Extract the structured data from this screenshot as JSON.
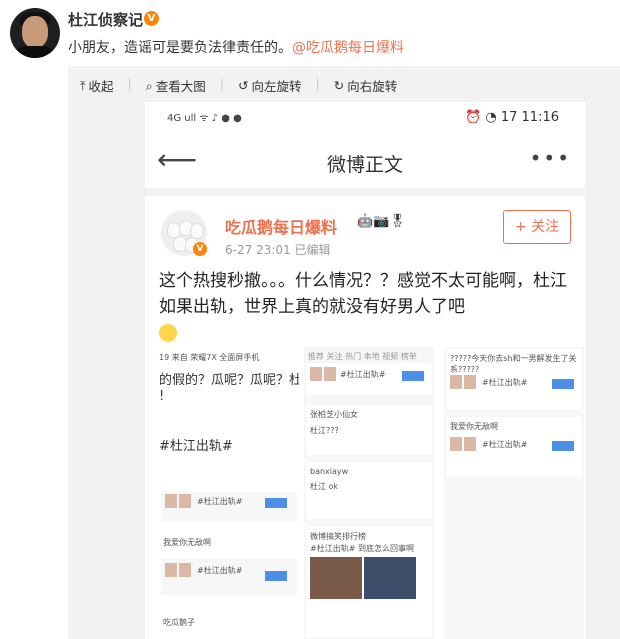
{
  "post": {
    "username": "杜江侦察记",
    "verified_badge": "V",
    "text": "小朋友，造谣可是要负法律责任的。",
    "mention": "@吃瓜鹅每日爆料"
  },
  "toolbar": {
    "items": [
      {
        "icon": "collapse-icon",
        "glyph": "⤒",
        "label": "收起"
      },
      {
        "icon": "search-icon",
        "glyph": "⌕",
        "label": "查看大图"
      },
      {
        "icon": "rotate-left-icon",
        "glyph": "↺",
        "label": "向左旋转"
      },
      {
        "icon": "rotate-right-icon",
        "glyph": "↻",
        "label": "向右旋转"
      }
    ]
  },
  "screenshot": {
    "status_left": "4G ull ᯤ ♪ ● ●",
    "status_right": "⏰ ◔ 17 11:16",
    "nav_title": "微博正文",
    "back_glyph": "⟵",
    "more_glyph": "•••",
    "repost": {
      "name": "吃瓜鹅每日爆料",
      "meta": "6-27 23:01  已编辑",
      "follow_label": "+ 关注",
      "badges": "🤖📷🎖",
      "text": "这个热搜秒撤。。。什么情况？？感觉不太可能啊，杜江如果出轨，世界上真的就没有好男人了吧"
    },
    "left_col": {
      "line1": "19  来自 荣耀7X 全面屏手机",
      "line2": "的假的？瓜呢？瓜呢？杜江和",
      "line3": "!",
      "line4": "#杜江出轨#",
      "card1": "#杜江出轨#",
      "card2_user": "我爱你无敌啊",
      "card2_text": "#杜江出轨#",
      "card3_user": "吃瓜鹅子"
    },
    "mid_col": {
      "tabs": "推荐  关注  热门  本地  视频  榜单",
      "card1": "#杜江出轨#",
      "user2": "张柏芝小仙女",
      "text2": "杜江???",
      "user3": "banxiayw",
      "text3": "杜江 ok",
      "user4": "微博搞笑排行榜",
      "text4": "#杜江出轨# 到底怎么回事啊"
    },
    "right_col": {
      "text1": "?????今天你去sh和一男解发生了关系?????",
      "card1": "#杜江出轨#",
      "user2": "我爱你无敌啊",
      "card2": "#杜江出轨#"
    }
  }
}
